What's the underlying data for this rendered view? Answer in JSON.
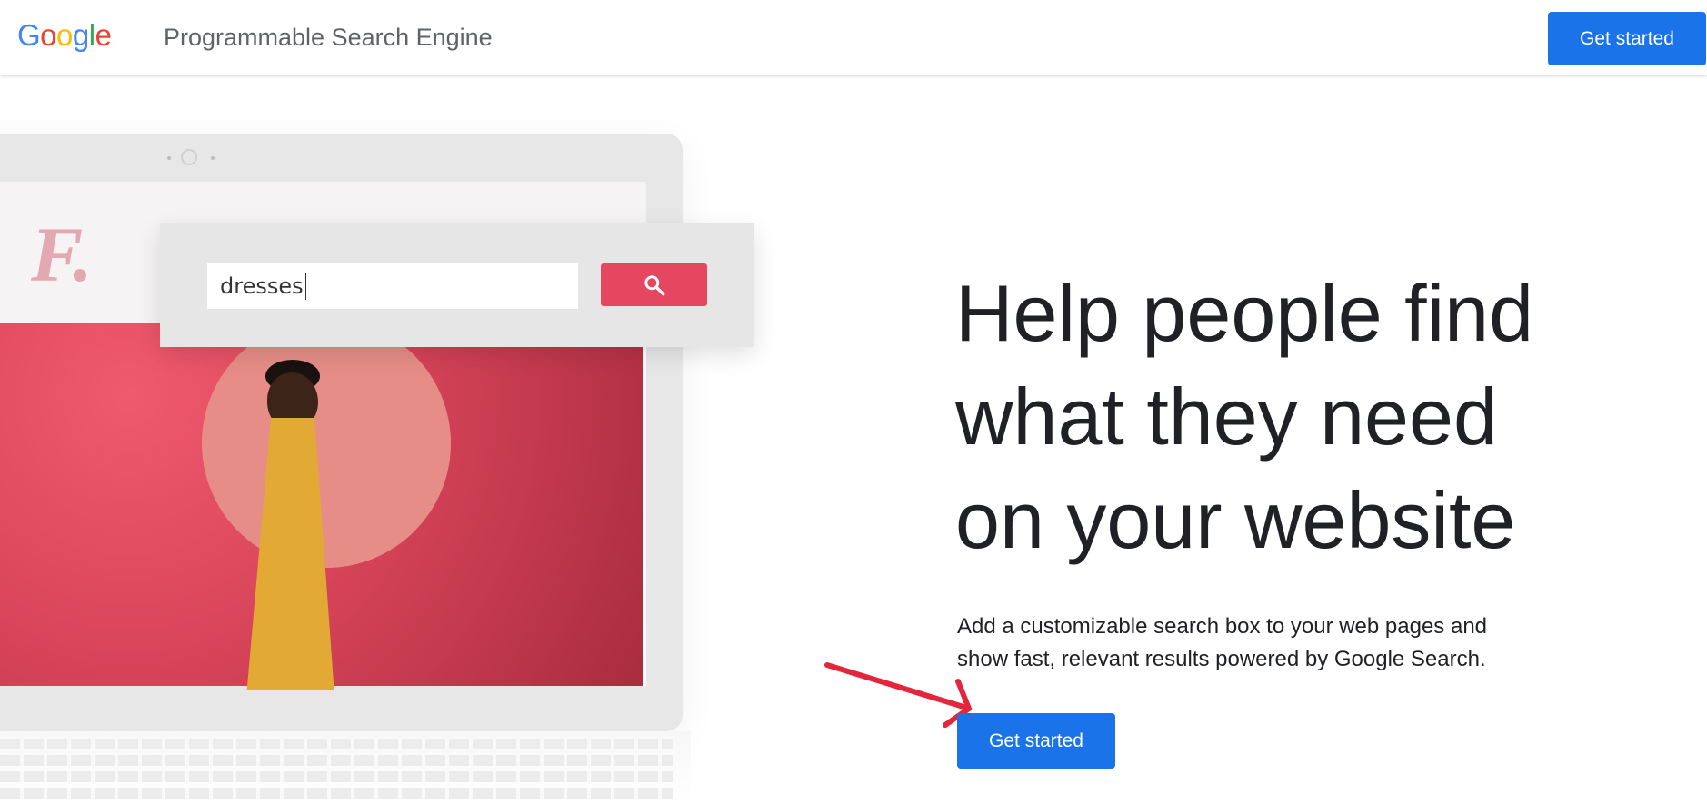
{
  "header": {
    "logo": {
      "letters": [
        {
          "char": "G",
          "color": "#4285F4"
        },
        {
          "char": "o",
          "color": "#EA4335"
        },
        {
          "char": "o",
          "color": "#FBBC05"
        },
        {
          "char": "g",
          "color": "#4285F4"
        },
        {
          "char": "l",
          "color": "#34A853"
        },
        {
          "char": "e",
          "color": "#EA4335"
        }
      ]
    },
    "product_name": "Programmable Search Engine",
    "cta_label": "Get started"
  },
  "illustration": {
    "brand_mark": "F.",
    "search_value": "dresses",
    "search_icon": "search-icon"
  },
  "hero": {
    "headline_lines": [
      "Help people find",
      "what they need",
      "on your website"
    ],
    "subtext_lines": [
      "Add a customizable search box to your web pages and",
      "show fast, relevant results powered by Google Search."
    ],
    "cta_label": "Get started"
  },
  "annotation": {
    "arrow_color": "#e3263c"
  },
  "colors": {
    "primary": "#1a73e8",
    "accent": "#e4475f"
  }
}
